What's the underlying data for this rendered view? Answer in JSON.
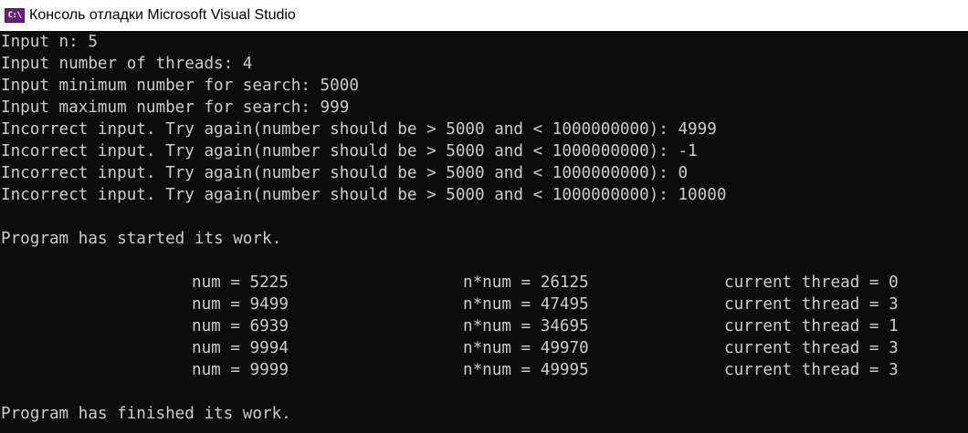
{
  "window": {
    "title": "Консоль отладки Microsoft Visual Studio",
    "icon": "visual-studio-console-icon",
    "icon_glyph": "C:\\",
    "icon_color": "#68217a",
    "background": "#0c0c0c",
    "foreground": "#cccccc"
  },
  "console": {
    "prompt_lines": [
      "Input n: 5",
      "Input number of threads: 4",
      "Input minimum number for search: 5000",
      "Input maximum number for search: 999",
      "Incorrect input. Try again(number should be > 5000 and < 1000000000): 4999",
      "Incorrect input. Try again(number should be > 5000 and < 1000000000): -1",
      "Incorrect input. Try again(number should be > 5000 and < 1000000000): 0",
      "Incorrect input. Try again(number should be > 5000 and < 1000000000): 10000"
    ],
    "started_message": "Program has started its work.",
    "results": [
      {
        "num": "num = 5225",
        "nnum": "n*num = 26125",
        "thread": "current thread = 0"
      },
      {
        "num": "num = 9499",
        "nnum": "n*num = 47495",
        "thread": "current thread = 3"
      },
      {
        "num": "num = 6939",
        "nnum": "n*num = 34695",
        "thread": "current thread = 1"
      },
      {
        "num": "num = 9994",
        "nnum": "n*num = 49970",
        "thread": "current thread = 3"
      },
      {
        "num": "num = 9999",
        "nnum": "n*num = 49995",
        "thread": "current thread = 3"
      }
    ],
    "finished_message": "Program has finished its work."
  }
}
